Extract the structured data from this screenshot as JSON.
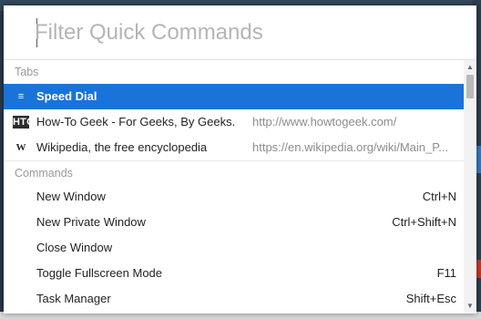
{
  "search": {
    "placeholder": "Filter Quick Commands",
    "value": ""
  },
  "sections": {
    "tabs_label": "Tabs",
    "commands_label": "Commands"
  },
  "tabs": [
    {
      "title": "Speed Dial",
      "url": "",
      "icon": "speed-dial-icon"
    },
    {
      "title": "How-To Geek - For Geeks, By Geeks.",
      "url": "http://www.howtogeek.com/",
      "icon": "htg-favicon",
      "icon_text": "HTG"
    },
    {
      "title": "Wikipedia, the free encyclopedia",
      "url": "https://en.wikipedia.org/wiki/Main_P...",
      "icon": "wikipedia-favicon",
      "icon_text": "W"
    }
  ],
  "commands": [
    {
      "label": "New Window",
      "shortcut": "Ctrl+N"
    },
    {
      "label": "New Private Window",
      "shortcut": "Ctrl+Shift+N"
    },
    {
      "label": "Close Window",
      "shortcut": ""
    },
    {
      "label": "Toggle Fullscreen Mode",
      "shortcut": "F11"
    },
    {
      "label": "Task Manager",
      "shortcut": "Shift+Esc"
    }
  ],
  "colors": {
    "selection": "#1a73d9",
    "section_text": "#9a9a9a",
    "url_text": "#8c8c8c"
  }
}
